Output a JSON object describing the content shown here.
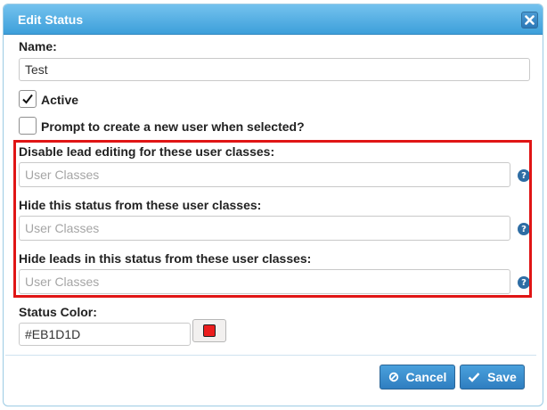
{
  "dialog": {
    "title": "Edit Status",
    "close_icon": "close-icon"
  },
  "name_field": {
    "label": "Name:",
    "value": "Test"
  },
  "active_checkbox": {
    "label": "Active",
    "checked": true
  },
  "prompt_checkbox": {
    "label": "Prompt to create a new user when selected?",
    "checked": false
  },
  "user_class_fields": [
    {
      "label": "Disable lead editing for these user classes:",
      "placeholder": "User Classes"
    },
    {
      "label": "Hide this status from these user classes:",
      "placeholder": "User Classes"
    },
    {
      "label": "Hide leads in this status from these user classes:",
      "placeholder": "User Classes"
    }
  ],
  "status_color": {
    "label": "Status Color:",
    "value": "#EB1D1D",
    "swatch_color": "#EB1D1D"
  },
  "help_icon_text": "?",
  "buttons": {
    "cancel_label": "Cancel",
    "save_label": "Save"
  },
  "colors": {
    "title_bar": "#3d9fda",
    "button": "#2f7ec0",
    "highlight": "#e01515"
  }
}
